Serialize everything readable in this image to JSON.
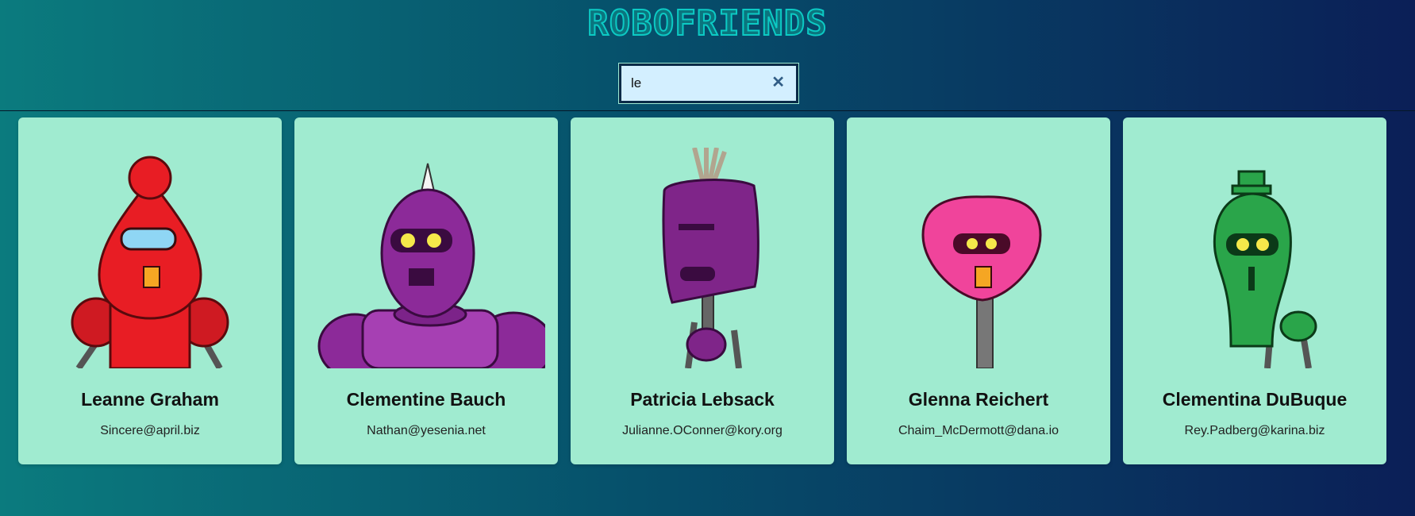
{
  "header": {
    "title": "ROBOFRIENDS",
    "search": {
      "value": "le",
      "clear_icon": "close-icon"
    }
  },
  "robots": [
    {
      "name": "Leanne Graham",
      "email": "Sincere@april.biz",
      "color": "#e81d24"
    },
    {
      "name": "Clementine Bauch",
      "email": "Nathan@yesenia.net",
      "color": "#8c2a99"
    },
    {
      "name": "Patricia Lebsack",
      "email": "Julianne.OConner@kory.org",
      "color": "#7f2589"
    },
    {
      "name": "Glenna Reichert",
      "email": "Chaim_McDermott@dana.io",
      "color": "#f0449b"
    },
    {
      "name": "Clementina DuBuque",
      "email": "Rey.Padberg@karina.biz",
      "color": "#2aa54a"
    }
  ]
}
